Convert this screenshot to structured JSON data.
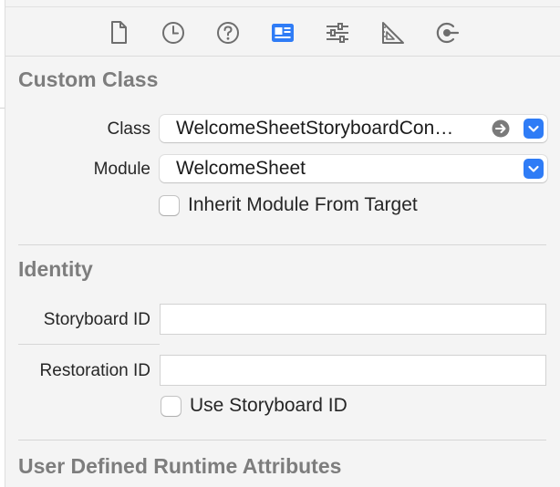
{
  "toolbar": {
    "icons": [
      {
        "name": "file-inspector-icon"
      },
      {
        "name": "history-inspector-icon"
      },
      {
        "name": "quick-help-icon"
      },
      {
        "name": "identity-inspector-icon",
        "selected": true
      },
      {
        "name": "attributes-inspector-icon"
      },
      {
        "name": "size-inspector-icon"
      },
      {
        "name": "connections-inspector-icon"
      }
    ],
    "selected_color": "#2f7cf6",
    "icon_color": "#6e6e6e"
  },
  "custom_class": {
    "title": "Custom Class",
    "class_label": "Class",
    "class_value": "WelcomeSheetStoryboardCon…",
    "module_label": "Module",
    "module_value": "WelcomeSheet",
    "inherit_label": "Inherit Module From Target",
    "inherit_checked": false
  },
  "identity": {
    "title": "Identity",
    "storyboard_id_label": "Storyboard ID",
    "storyboard_id_value": "",
    "restoration_id_label": "Restoration ID",
    "restoration_id_value": "",
    "use_storyboard_label": "Use Storyboard ID",
    "use_storyboard_checked": false
  },
  "runtime_attributes": {
    "title": "User Defined Runtime Attributes"
  }
}
